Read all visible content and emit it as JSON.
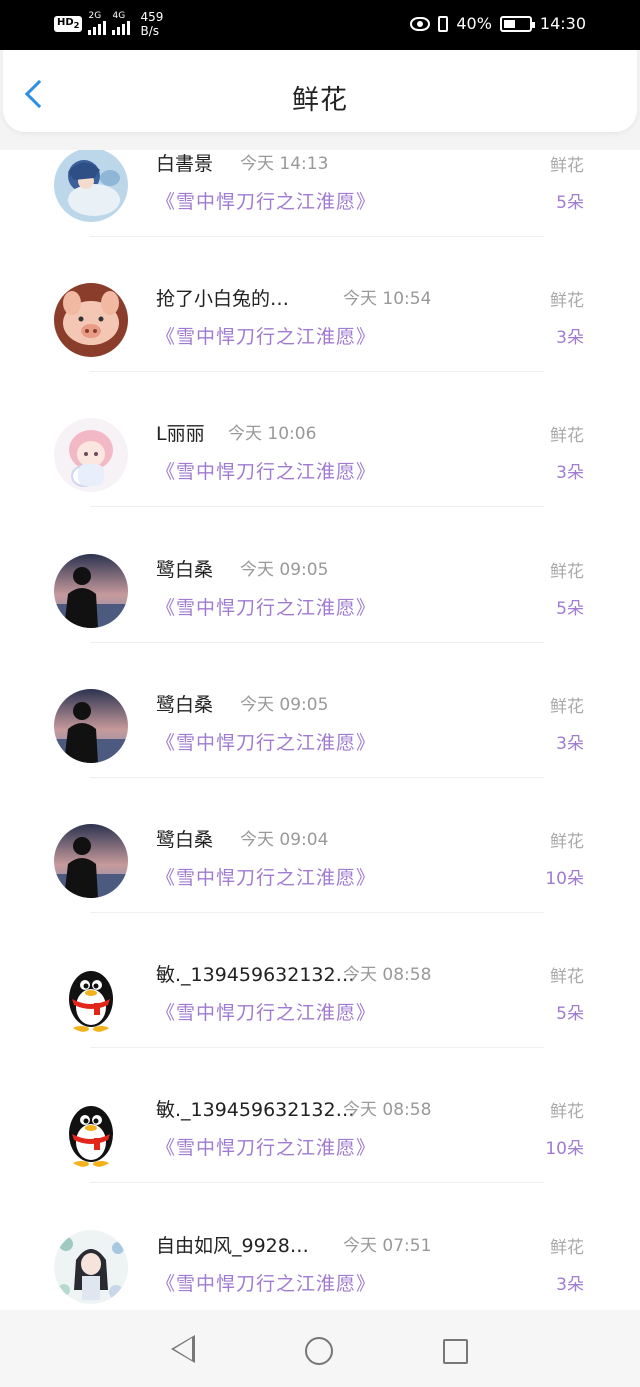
{
  "status_bar": {
    "hd_label": "HD",
    "hd_sub": "2",
    "sig1_label": "2G",
    "sig2_label": "4G",
    "net_speed_value": "459",
    "net_speed_unit": "B/s",
    "battery": "40%",
    "time": "14:30",
    "icons": [
      "eye-icon",
      "vibrate-icon",
      "battery-icon"
    ]
  },
  "header": {
    "title": "鲜花",
    "back_icon": "chevron-left-icon",
    "accent_color": "#2a8fe6"
  },
  "colors": {
    "book": "#a07bd0",
    "time": "#999999",
    "gift": "#aaaaaa"
  },
  "rows": [
    {
      "name": "白書景",
      "time": "今天 14:13",
      "book": "《雪中悍刀行之江淮愿》",
      "gift": "鲜花",
      "count": "5朵",
      "avatar": "anime-boy-avatar"
    },
    {
      "name": "抢了小白兔的…",
      "time": "今天 10:54",
      "book": "《雪中悍刀行之江淮愿》",
      "gift": "鲜花",
      "count": "3朵",
      "avatar": "piglet-avatar"
    },
    {
      "name": "L丽丽",
      "time": "今天 10:06",
      "book": "《雪中悍刀行之江淮愿》",
      "gift": "鲜花",
      "count": "3朵",
      "avatar": "anime-girl-avatar"
    },
    {
      "name": "鹭白桑",
      "time": "今天 09:05",
      "book": "《雪中悍刀行之江淮愿》",
      "gift": "鲜花",
      "count": "5朵",
      "avatar": "silhouette-avatar"
    },
    {
      "name": "鹭白桑",
      "time": "今天 09:05",
      "book": "《雪中悍刀行之江淮愿》",
      "gift": "鲜花",
      "count": "3朵",
      "avatar": "silhouette-avatar"
    },
    {
      "name": "鹭白桑",
      "time": "今天 09:04",
      "book": "《雪中悍刀行之江淮愿》",
      "gift": "鲜花",
      "count": "10朵",
      "avatar": "silhouette-avatar"
    },
    {
      "name": "敏._139459632132…",
      "time": "今天 08:58",
      "book": "《雪中悍刀行之江淮愿》",
      "gift": "鲜花",
      "count": "5朵",
      "avatar": "qq-penguin-avatar"
    },
    {
      "name": "敏._139459632132…",
      "time": "今天 08:58",
      "book": "《雪中悍刀行之江淮愿》",
      "gift": "鲜花",
      "count": "10朵",
      "avatar": "qq-penguin-avatar"
    },
    {
      "name": "自由如风_9928…",
      "time": "今天 07:51",
      "book": "《雪中悍刀行之江淮愿》",
      "gift": "鲜花",
      "count": "3朵",
      "avatar": "anime-girl-flowers-avatar"
    }
  ],
  "nav_bar": {
    "icons": [
      "nav-back-icon",
      "nav-home-icon",
      "nav-recents-icon"
    ]
  }
}
